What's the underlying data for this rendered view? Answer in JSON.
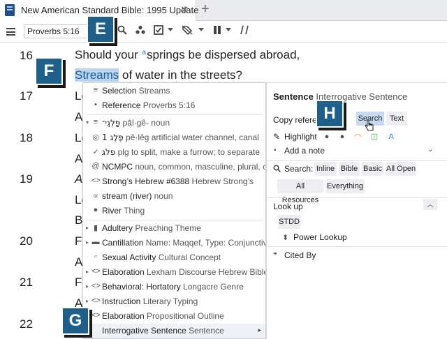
{
  "tab": {
    "title": "New American Standard Bible: 1995 Update",
    "close": "✕",
    "add": "+"
  },
  "toolbar": {
    "reference": "Proverbs 5:16",
    "icons": [
      "search-icon",
      "dots-icon",
      "check-box-icon",
      "tag-icon",
      "columns-icon",
      "slash-icon"
    ]
  },
  "callouts": {
    "E": "E",
    "F": "F",
    "G": "G",
    "H": "H"
  },
  "verses": [
    {
      "num": "16",
      "line1_pre": "Should your ",
      "line1_sup": "a",
      "line1_post": "springs be dispersed abroad,",
      "sel": "Streams",
      "line2_post": " of water in the streets?"
    },
    {
      "num": "17",
      "frag": "Le"
    },
    {
      "num": "",
      "frag": "A"
    },
    {
      "num": "18",
      "frag": "Le"
    },
    {
      "num": "",
      "frag": "A"
    },
    {
      "num": "19",
      "frag": "As"
    },
    {
      "num": "",
      "frag": "Le"
    },
    {
      "num": "",
      "frag": "Be"
    },
    {
      "num": "20",
      "frag": "Fo"
    },
    {
      "num": "",
      "frag": "A"
    },
    {
      "num": "21",
      "frag": "Fo"
    },
    {
      "num": "",
      "frag": "A"
    },
    {
      "num": "22",
      "frag": "Hi"
    }
  ],
  "menu": {
    "items": [
      {
        "icon": "≡",
        "label": "Selection",
        "sub": " Streams"
      },
      {
        "icon": "▪",
        "label": "Reference",
        "sub": " Proverbs 5:16"
      },
      {
        "icon": "≡",
        "label": "פַּלְגֵי־",
        "sub": " păl·gê- noun",
        "heb": true,
        "arrow": true
      },
      {
        "icon": "◎",
        "label": "פֶּלֶג 1",
        "sub": " pĕ·lĕg artificial water channel, canal",
        "heb": true
      },
      {
        "icon": "✓",
        "label": "פלג",
        "sub": " plg to split, make a furrow; to separate",
        "heb": true
      },
      {
        "icon": "@",
        "label": "NCMPC",
        "sub": " noun, common, masculine, plural, c…"
      },
      {
        "icon": "<>",
        "label": "Strong’s Hebrew #6388",
        "sub": " Hebrew Strong’s"
      },
      {
        "icon": "∝",
        "label": "stream (river)",
        "sub": " noun"
      },
      {
        "icon": "●",
        "label": "River",
        "sub": " Thing"
      },
      {
        "icon": "▮",
        "label": "Adultery",
        "sub": " Preaching Theme",
        "arrow": true
      },
      {
        "icon": "▬",
        "label": "Cantillation",
        "sub": " Name: Maqqef, Type: Conjunctive",
        "arrow": true
      },
      {
        "icon": "▫",
        "label": "Sexual Activity",
        "sub": " Cultural Concept"
      },
      {
        "icon": "<>",
        "label": "Elaboration",
        "sub": " Lexham Discourse Hebrew Bible",
        "arrow": true
      },
      {
        "icon": "<>",
        "label": "Behavioral: Hortatory",
        "sub": " Longacre Genre",
        "arrow": true
      },
      {
        "icon": "<>",
        "label": "Instruction",
        "sub": " Literary Typing",
        "arrow": true
      },
      {
        "icon": "<>",
        "label": "Elaboration",
        "sub": " Propositional Outline",
        "arrow": true
      },
      {
        "icon": "",
        "label": "Interrogative Sentence",
        "sub": " Sentence",
        "chevron": "▸"
      }
    ]
  },
  "panel": {
    "title_bold": "Sentence",
    "title_sub": " Interrogative Sentence",
    "copy_label": "Copy referen",
    "search_btn": "Search",
    "text_btn": "Text",
    "highlight_label": "Highlight",
    "add_note_label": "Add a note",
    "search_label": "Search:",
    "search_opts": [
      "Inline",
      "Bible",
      "Basic",
      "All Open"
    ],
    "search_opts2": [
      "All Resources",
      "Everything"
    ],
    "lookup_label": "Look up",
    "stdd_btn": "STDD",
    "power_lookup": "Power Lookup",
    "cited_by": "Cited By",
    "highlight_colors": [
      "#555555",
      "#555555",
      "#e07a2e",
      "#4aa04a",
      "#3a86c8"
    ]
  }
}
